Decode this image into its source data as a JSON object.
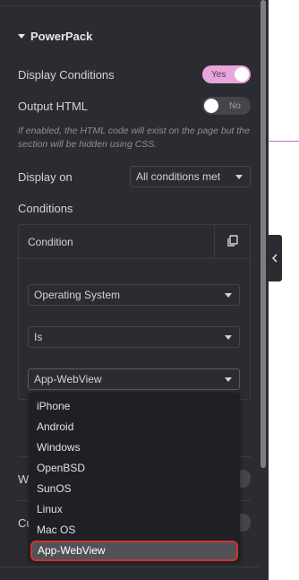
{
  "section": {
    "title": "PowerPack"
  },
  "display_conditions": {
    "label": "Display Conditions",
    "toggle_text": "Yes"
  },
  "output_html": {
    "label": "Output HTML",
    "toggle_text": "No",
    "help": "If enabled, the HTML code will exist on the page but the section will be hidden using CSS."
  },
  "display_on": {
    "label": "Display on",
    "value": "All conditions met"
  },
  "conditions": {
    "label": "Conditions",
    "item_label": "Condition",
    "type_value": "Operating System",
    "operator_value": "Is",
    "value_selected": "App-WebView",
    "options": [
      "iPhone",
      "Android",
      "Windows",
      "OpenBSD",
      "SunOS",
      "Linux",
      "Mac OS",
      "App-WebView"
    ]
  },
  "partially_hidden_rows": [
    {
      "label_fragment": "W"
    },
    {
      "label_fragment": "Cu"
    }
  ],
  "icons": {
    "collapse": "chevron-left-icon",
    "duplicate": "copy-icon",
    "caret": "caret-down-icon"
  },
  "colors": {
    "panel_bg": "#2b2c31",
    "toggle_on": "#e7a6dc",
    "selected_outline": "#d23030"
  }
}
